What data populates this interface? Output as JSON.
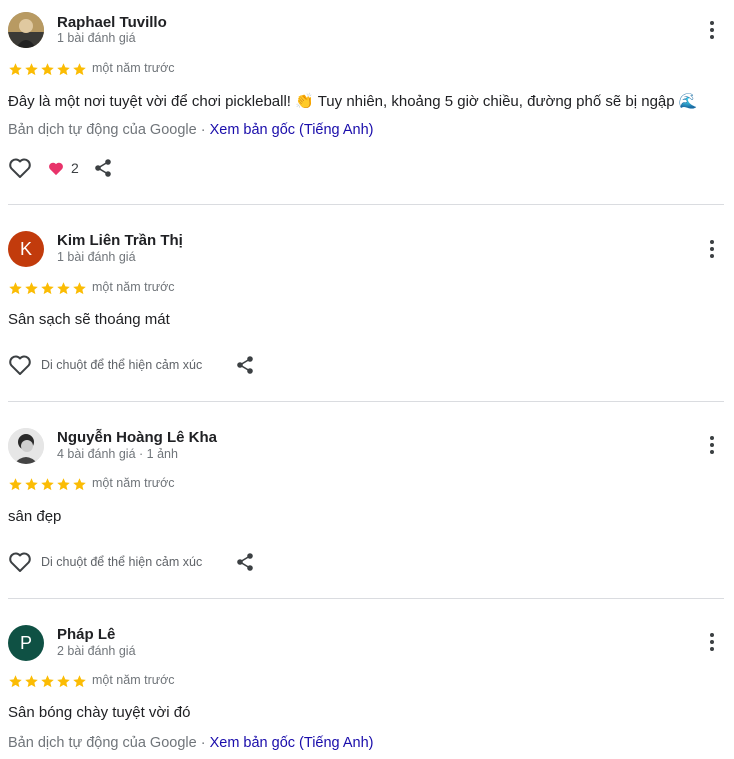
{
  "common": {
    "when": "một năm trước",
    "translated_by": "Bản dịch tự động của Google",
    "separator": "·",
    "view_original": "Xem bản gốc (Tiếng Anh)",
    "react_hint": "Di chuột để thể hiện cảm xúc",
    "rating": 5,
    "star_color": "#fbbc04",
    "link_color": "#1a0dab"
  },
  "reviews": [
    {
      "author": "Raphael Tuvillo",
      "meta": "1 bài đánh giá",
      "text": "Đây là một nơi tuyệt vời để chơi pickleball! 👏 Tuy nhiên, khoảng 5 giờ chiều, đường phố sẽ bị ngập 🌊",
      "reaction_count": "2",
      "avatar_icon": "photo-avatar"
    },
    {
      "author": "Kim Liên Trần Thị",
      "meta": "1 bài đánh giá",
      "text": "Sân sạch sẽ thoáng mát",
      "avatar_letter": "K",
      "avatar_color": "#c23b0c"
    },
    {
      "author": "Nguyễn Hoàng Lê Kha",
      "meta": "4 bài đánh giá · 1 ảnh",
      "text": "sân đẹp",
      "avatar_icon": "photo-avatar"
    },
    {
      "author": "Pháp Lê",
      "meta": "2 bài đánh giá",
      "text": "Sân bóng chày tuyệt vời đó",
      "avatar_letter": "P",
      "avatar_color": "#0f5144"
    }
  ]
}
